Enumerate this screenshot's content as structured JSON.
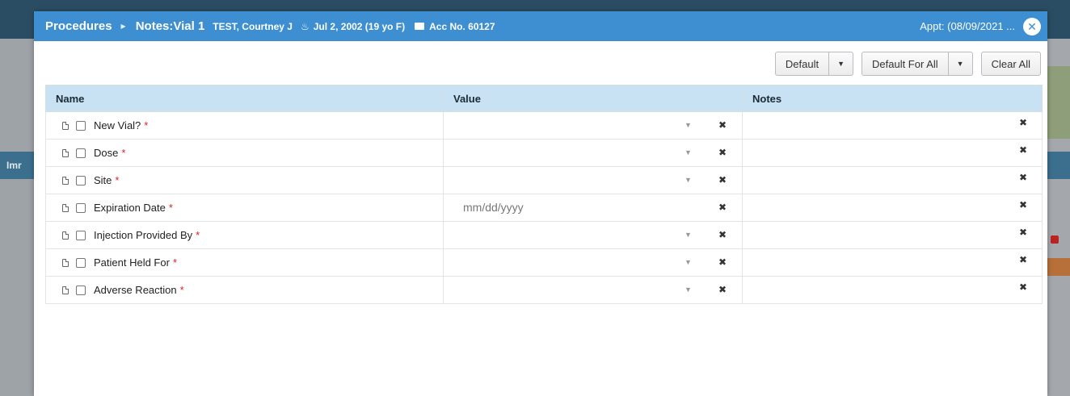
{
  "background": {
    "left_tab_label": "Imr"
  },
  "header": {
    "title": "Procedures",
    "subtitle": "Notes:Vial 1",
    "patient": "TEST, Courtney J",
    "dob": "Jul 2, 2002 (19 yo F)",
    "acc": "Acc No. 60127",
    "appt": "Appt: (08/09/2021 ...",
    "close_glyph": "✕"
  },
  "toolbar": {
    "default_label": "Default",
    "default_for_all_label": "Default For All",
    "clear_all_label": "Clear All",
    "caret_glyph": "▼"
  },
  "table": {
    "columns": [
      "Name",
      "Value",
      "Notes"
    ],
    "rows": [
      {
        "name": "New Vial?",
        "value_placeholder": "",
        "type": "select"
      },
      {
        "name": "Dose",
        "value_placeholder": "",
        "type": "select"
      },
      {
        "name": "Site",
        "value_placeholder": "",
        "type": "select"
      },
      {
        "name": "Expiration Date",
        "value_placeholder": "mm/dd/yyyy",
        "type": "date"
      },
      {
        "name": "Injection Provided By",
        "value_placeholder": "",
        "type": "select"
      },
      {
        "name": "Patient Held For",
        "value_placeholder": "",
        "type": "select"
      },
      {
        "name": "Adverse Reaction",
        "value_placeholder": "",
        "type": "select"
      }
    ],
    "required_marker": "*",
    "clear_glyph": "✖",
    "dropdown_glyph": "▼"
  },
  "colors": {
    "header_bg": "#3d8fd1",
    "table_header_bg": "#c8e2f4",
    "required": "#dd2222"
  }
}
